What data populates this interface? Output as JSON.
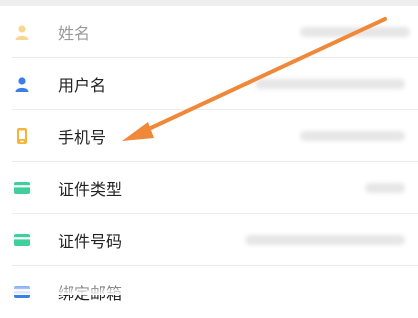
{
  "colors": {
    "arrow": "#f0883a",
    "icon_yellow": "#f5b53c",
    "icon_blue": "#3a7ee8",
    "icon_green": "#3fcf9a",
    "text": "#222222"
  },
  "list": {
    "items": [
      {
        "label": "姓名",
        "icon": "person-icon",
        "color": "#f5b53c",
        "faded": true,
        "has_value": true
      },
      {
        "label": "用户名",
        "icon": "person-icon",
        "color": "#3a7ee8",
        "faded": false,
        "has_value": true
      },
      {
        "label": "手机号",
        "icon": "phone-icon",
        "color": "#f5b53c",
        "faded": false,
        "has_value": true
      },
      {
        "label": "证件类型",
        "icon": "card-icon",
        "color": "#3fcf9a",
        "faded": false,
        "has_value": true
      },
      {
        "label": "证件号码",
        "icon": "card-icon",
        "color": "#3fcf9a",
        "faded": false,
        "has_value": true
      },
      {
        "label": "绑定邮箱",
        "icon": "card-icon",
        "color": "#3a7ee8",
        "faded": false,
        "has_value": false
      }
    ]
  },
  "annotation": {
    "icon": "arrow-icon",
    "target": "手机号"
  }
}
